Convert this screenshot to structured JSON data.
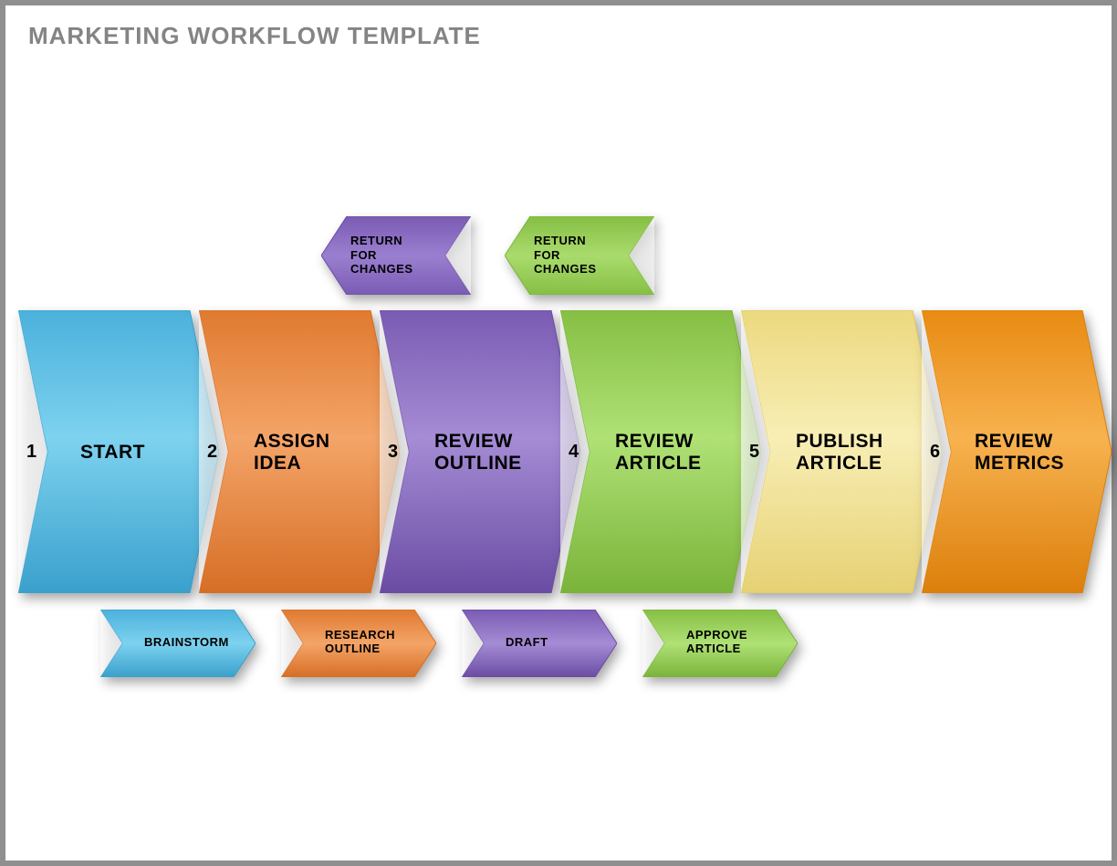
{
  "title": "MARKETING WORKFLOW TEMPLATE",
  "colors": {
    "blue": "#5ec1e8",
    "orange1": "#ed8d47",
    "purple": "#8c6fc1",
    "green": "#99ce5a",
    "yellow": "#f3e59a",
    "orange2": "#f29c1f"
  },
  "steps": [
    {
      "num": "1",
      "label": "START"
    },
    {
      "num": "2",
      "label": "ASSIGN IDEA"
    },
    {
      "num": "3",
      "label": "REVIEW OUTLINE"
    },
    {
      "num": "4",
      "label": "REVIEW ARTICLE"
    },
    {
      "num": "5",
      "label": "PUBLISH ARTICLE"
    },
    {
      "num": "6",
      "label": "REVIEW METRICS"
    }
  ],
  "returns": [
    {
      "label": "RETURN FOR CHANGES"
    },
    {
      "label": "RETURN FOR CHANGES"
    }
  ],
  "advance": [
    {
      "label": "BRAINSTORM"
    },
    {
      "label": "RESEARCH OUTLINE"
    },
    {
      "label": "DRAFT"
    },
    {
      "label": "APPROVE ARTICLE"
    }
  ]
}
